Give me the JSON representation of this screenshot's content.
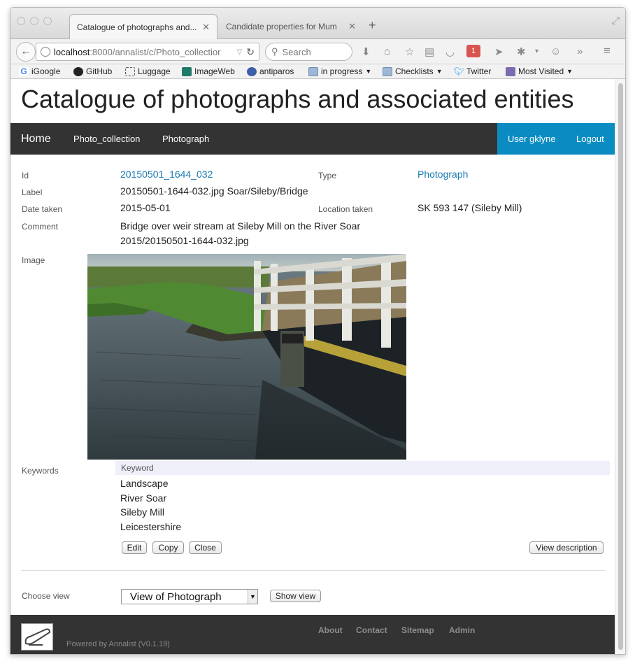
{
  "browser": {
    "tabs": [
      {
        "label": "Catalogue of photographs and...",
        "active": true
      },
      {
        "label": "Candidate properties for Mum",
        "active": false
      }
    ],
    "url_host": "localhost",
    "url_path": ":8000/annalist/c/Photo_collectior",
    "search_placeholder": "Search",
    "addon_badge": "1",
    "bookmarks": [
      "iGoogle",
      "GitHub",
      "Luggage",
      "ImageWeb",
      "antiparos",
      "in progress",
      "Checklists",
      "Twitter",
      "Most Visited"
    ]
  },
  "page": {
    "title": "Catalogue of photographs and associated entities",
    "nav": {
      "home": "Home",
      "collection": "Photo_collection",
      "photograph": "Photograph",
      "user": "User gklyne",
      "logout": "Logout"
    },
    "colors": {
      "nav_bg": "#333333",
      "user_bg": "#0a8cc3",
      "link": "#1a7ab3"
    }
  },
  "record": {
    "id_label": "Id",
    "id_value": "20150501_1644_032",
    "type_label": "Type",
    "type_value": "Photograph",
    "label_label": "Label",
    "label_value": "20150501-1644-032.jpg Soar/Sileby/Bridge",
    "date_label": "Date taken",
    "date_value": "2015-05-01",
    "location_label": "Location taken",
    "location_value": "SK 593 147 (Sileby Mill)",
    "comment_label": "Comment",
    "comment_value": "Bridge over weir stream at Sileby Mill on the River Soar",
    "file_value": "2015/20150501-1644-032.jpg",
    "image_label": "Image"
  },
  "keywords": {
    "label": "Keywords",
    "header": "Keyword",
    "items": [
      "Landscape",
      "River Soar",
      "Sileby Mill",
      "Leicestershire"
    ]
  },
  "buttons": {
    "edit": "Edit",
    "copy": "Copy",
    "close": "Close",
    "view_description": "View description",
    "show_view": "Show view"
  },
  "view_chooser": {
    "label": "Choose view",
    "selected": "View of Photograph"
  },
  "footer": {
    "about": "About",
    "contact": "Contact",
    "sitemap": "Sitemap",
    "admin": "Admin",
    "powered": "Powered by Annalist (V0.1.19)"
  }
}
